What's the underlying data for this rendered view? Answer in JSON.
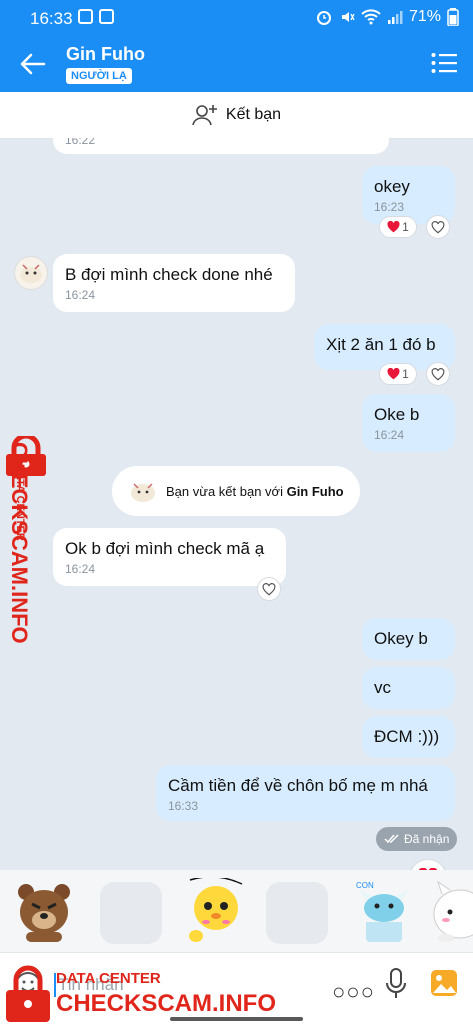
{
  "status_bar": {
    "time": "16:33",
    "battery": "71%"
  },
  "header": {
    "name": "Gin Fuho",
    "badge": "NGƯỜI LẠ"
  },
  "add_friend": {
    "label": "Kết bạn"
  },
  "messages": [
    {
      "text": "",
      "time": "16:22"
    },
    {
      "text": "okey",
      "time": "16:23",
      "reaction_count": "1"
    },
    {
      "text": "B đợi mình check done nhé",
      "time": "16:24"
    },
    {
      "text": "Xịt 2 ăn 1 đó b",
      "reaction_count": "1"
    },
    {
      "text": "Oke b",
      "time": "16:24"
    },
    {
      "text": "Ok b đợi mình check mã ạ",
      "time": "16:24"
    },
    {
      "text": "Okey b"
    },
    {
      "text": "vc"
    },
    {
      "text": "ĐCM :)))"
    },
    {
      "text": "Cầm tiền để về chôn bố mẹ m nhá",
      "time": "16:33"
    }
  ],
  "system_message": {
    "prefix": "Bạn vừa kết bạn với ",
    "name": "Gin Fuho"
  },
  "status_received": "Đã nhận",
  "input": {
    "placeholder": "Tin nhắn"
  },
  "watermark": {
    "data_center": "DATA CENTER",
    "brand": "CHECKSCAM.INFO"
  },
  "colors": {
    "accent": "#1b8ef5",
    "outgoing_bubble": "#d7ecfe",
    "incoming_bubble": "#ffffff",
    "heart": "#e8173a",
    "watermark": "#e0251b"
  },
  "icons": [
    "back-arrow-icon",
    "menu-list-icon",
    "add-person-icon",
    "heart-icon",
    "double-check-icon",
    "more-dots-icon",
    "mic-icon",
    "image-icon",
    "lock-icon"
  ]
}
